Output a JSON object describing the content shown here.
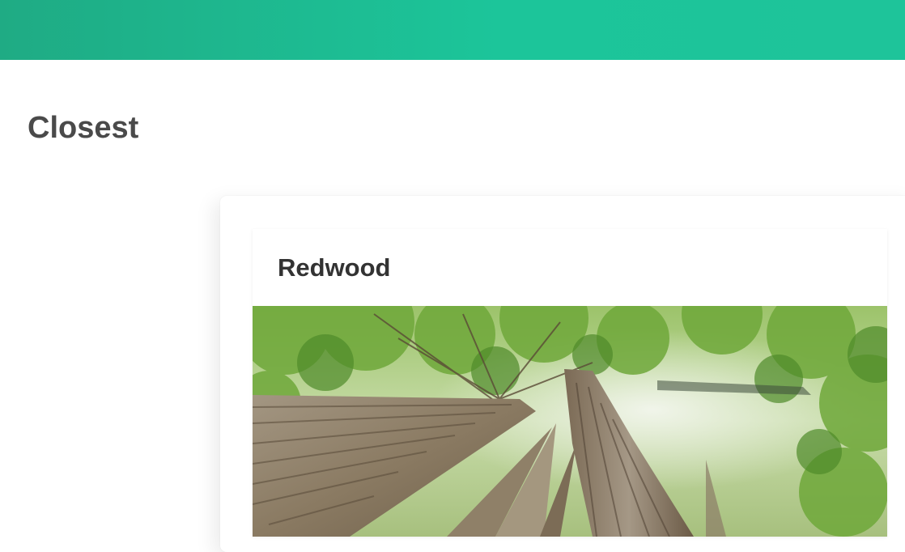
{
  "header": {
    "accent_color": "#1ec49a"
  },
  "main": {
    "title": "Closest",
    "card": {
      "title": "Redwood",
      "image": "redwood-forest-canopy-photo"
    }
  }
}
